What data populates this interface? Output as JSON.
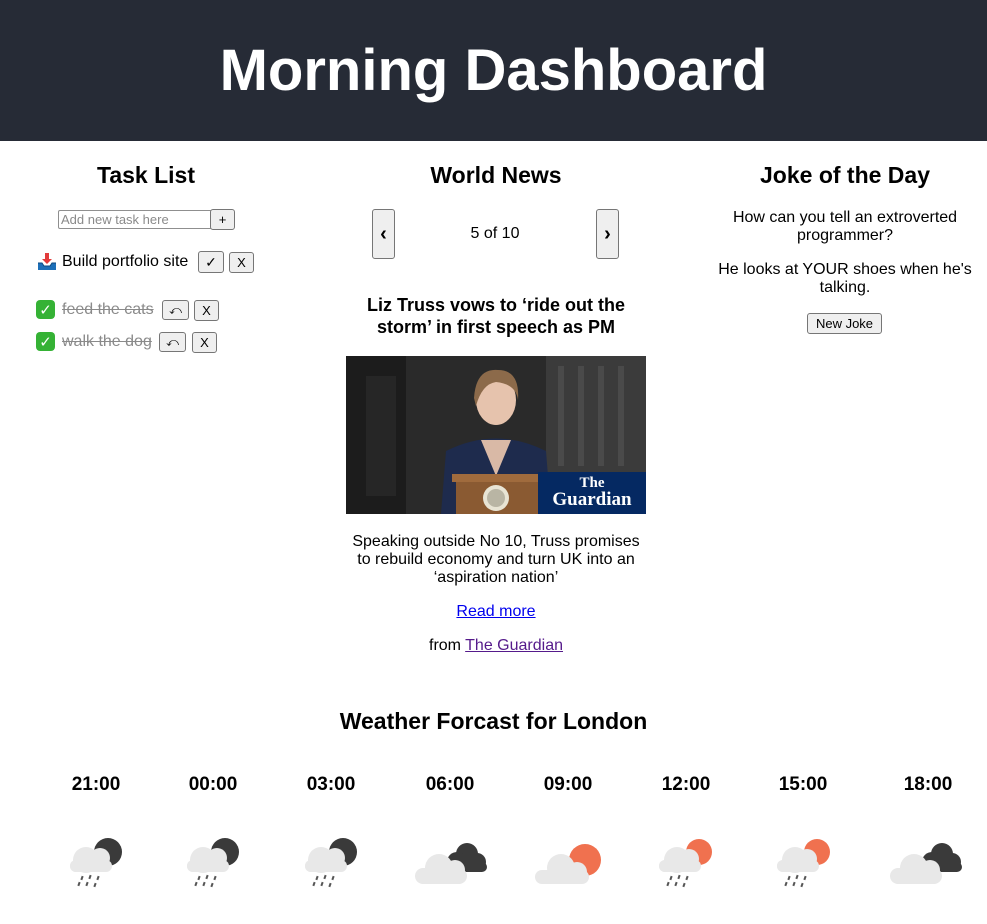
{
  "header": {
    "title": "Morning Dashboard"
  },
  "tasks": {
    "title": "Task List",
    "input_placeholder": "Add new task here",
    "add_label": "+",
    "complete_label": "✓",
    "undo_label": "⤺",
    "delete_label": "X",
    "items": [
      {
        "icon": "inbox-tray-icon",
        "text": "Build portfolio site",
        "done": false
      },
      {
        "icon": "check-mark-icon",
        "text": "feed the cats",
        "done": true
      },
      {
        "icon": "check-mark-icon",
        "text": "walk the dog",
        "done": true
      }
    ]
  },
  "news": {
    "title": "World News",
    "prev_label": "‹",
    "next_label": "›",
    "counter": "5 of 10",
    "headline": "Liz Truss vows to ‘ride out the storm’ in first speech as PM",
    "image_logo_line1": "The",
    "image_logo_line2": "Guardian",
    "summary": "Speaking outside No 10, Truss promises to rebuild economy and turn UK into an ‘aspiration nation’",
    "read_more": "Read more",
    "source_prefix": "from",
    "source": "The Guardian"
  },
  "joke": {
    "title": "Joke of the Day",
    "setup": "How can you tell an extroverted programmer?",
    "punchline": "He looks at YOUR shoes when he's talking.",
    "button_label": "New Joke"
  },
  "weather": {
    "title": "Weather Forcast for London",
    "slots": [
      {
        "time": "21:00",
        "icon": "night-rain-icon"
      },
      {
        "time": "00:00",
        "icon": "night-rain-icon"
      },
      {
        "time": "03:00",
        "icon": "night-rain-icon"
      },
      {
        "time": "06:00",
        "icon": "night-cloudy-icon"
      },
      {
        "time": "09:00",
        "icon": "partly-sunny-icon"
      },
      {
        "time": "12:00",
        "icon": "sun-rain-icon"
      },
      {
        "time": "15:00",
        "icon": "sun-rain-icon"
      },
      {
        "time": "18:00",
        "icon": "night-cloudy-icon"
      }
    ]
  },
  "colors": {
    "header_bg": "#262b36",
    "sun": "#f0714f",
    "moon": "#3a3a3a",
    "cloud": "#e8e8e8",
    "guardian_blue": "#052962"
  }
}
